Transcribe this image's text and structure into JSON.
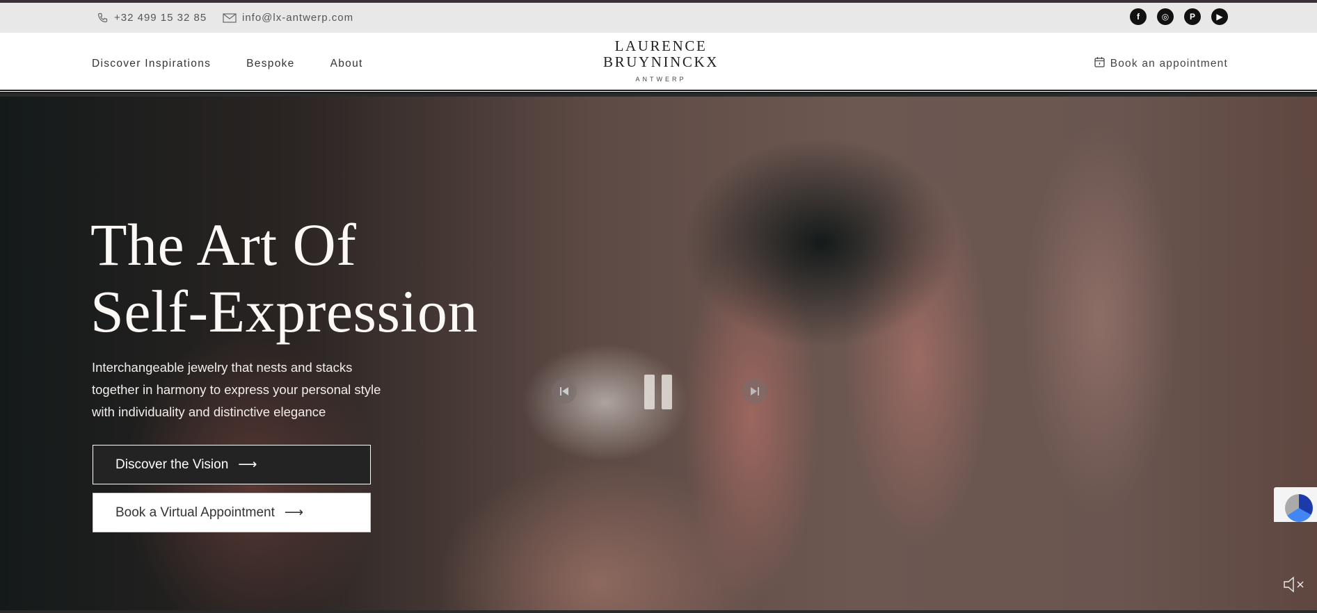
{
  "topbar": {
    "phone": "+32 499 15 32 85",
    "email": "info@lx-antwerp.com",
    "socials": [
      {
        "name": "facebook",
        "glyph": "f"
      },
      {
        "name": "instagram",
        "glyph": "◎"
      },
      {
        "name": "pinterest",
        "glyph": "P"
      },
      {
        "name": "youtube",
        "glyph": "▶"
      }
    ]
  },
  "header": {
    "nav": [
      "Discover Inspirations",
      "Bespoke",
      "About"
    ],
    "logo": {
      "line1": "LAURENCE",
      "line2": "BRUYNINCKX",
      "sub": "ANTWERP"
    },
    "book_label": "Book an appointment"
  },
  "hero": {
    "title_line1": "The Art Of",
    "title_line2": "Self-Expression",
    "subtitle": "Interchangeable jewelry that nests and stacks together in harmony to express your personal style with individuality and distinctive elegance",
    "primary_button": "Discover the Vision",
    "secondary_button": "Book a Virtual Appointment",
    "arrow": "⟶"
  },
  "colors": {
    "topbar_bg": "#e8e8e8",
    "header_bg": "#ffffff",
    "dark_button": "#232323",
    "text_light": "#fbf8f5"
  }
}
